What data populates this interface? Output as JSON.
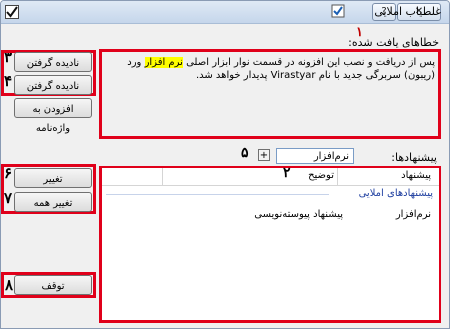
{
  "window": {
    "title": "غلطیاب املایی",
    "help_glyph": "?",
    "close_glyph": "✕"
  },
  "labels": {
    "errors_found": "خطاهای یافت شده:",
    "suggestions": "پیشنهادها:"
  },
  "text_content": {
    "part1": "پس از دریافت و نصب این افزونه در قسمت نوار ابزار اصلی ",
    "highlight": "نرم افزار",
    "part2": " ورد (ریبون) سربرگی جدید با نام Virastyar پدیدار خواهد شد."
  },
  "suggestion_field": {
    "value": "نرم‌افزار",
    "add_label": "+"
  },
  "buttons": {
    "ignore": "نادیده گرفتن",
    "ignore_all": "نادیده گرفتن همه",
    "add_dictionary": "افزودن به واژه‌نامه",
    "change": "تغییر",
    "change_all": "تغییر همه",
    "stop": "توقف"
  },
  "list": {
    "columns": [
      "پیشنهاد",
      "توضیح"
    ],
    "group_title": "پیشنهادهای املایی",
    "rows": [
      {
        "suggestion": "نرم‌افزار",
        "description": "پیشنهاد پیوسته‌نویسی"
      }
    ]
  },
  "callouts": [
    "۱",
    "۲",
    "۳",
    "۴",
    "۵",
    "۶",
    "۷",
    "۸"
  ],
  "colors": {
    "highlight": "#ffff00",
    "callout_box": "#e0001a",
    "group_title": "#1f3fa0"
  }
}
